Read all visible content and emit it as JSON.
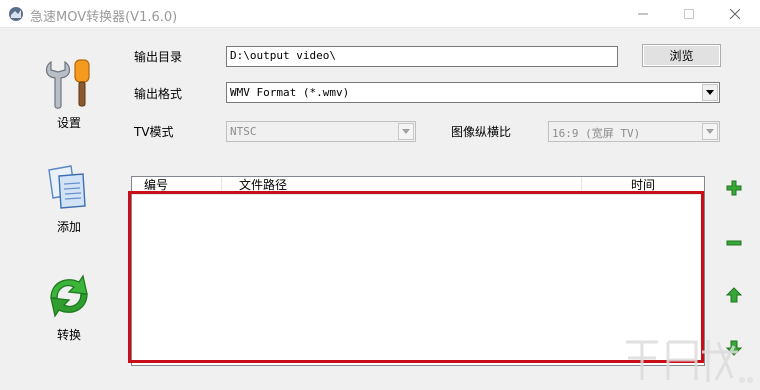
{
  "window": {
    "title": "急速MOV转换器(V1.6.0)"
  },
  "sidebar": {
    "settings_label": "设置",
    "add_label": "添加",
    "convert_label": "转换"
  },
  "form": {
    "output_dir_label": "输出目录",
    "output_dir_value": "D:\\output video\\",
    "browse_label": "浏览",
    "output_format_label": "输出格式",
    "output_format_value": "WMV Format (*.wmv)",
    "tv_mode_label": "TV模式",
    "tv_mode_value": "NTSC",
    "aspect_label": "图像纵横比",
    "aspect_value": "16:9  (宽屏 TV)"
  },
  "file_list": {
    "columns": [
      "编号",
      "文件路径",
      "时间"
    ],
    "rows": []
  },
  "colors": {
    "highlight": "#c80f19",
    "green_tools": "#2fa12f"
  }
}
